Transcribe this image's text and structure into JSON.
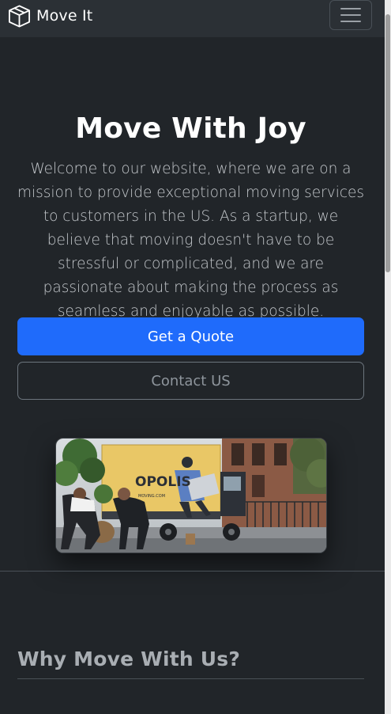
{
  "navbar": {
    "brand_text": "Move It",
    "brand_icon": "box-icon",
    "toggler_icon": "hamburger-menu-icon"
  },
  "hero": {
    "title": "Move With Joy",
    "lead": "Welcome to our website, where we are on a mission to provide exceptional moving services to customers in the US. As a startup, we believe that moving doesn't have to be stressful or complicated, and we are passionate about making the process as seamless and enjoyable as possible.",
    "primary_button": "Get a Quote",
    "secondary_button": "Contact US",
    "image_truck_text": "OPOLIS",
    "image_truck_small_text": "MOVING.COM"
  },
  "section": {
    "title": "Why Move With Us?"
  },
  "colors": {
    "background": "#212529",
    "navbar": "#2b3035",
    "primary": "#1f6bfb"
  }
}
